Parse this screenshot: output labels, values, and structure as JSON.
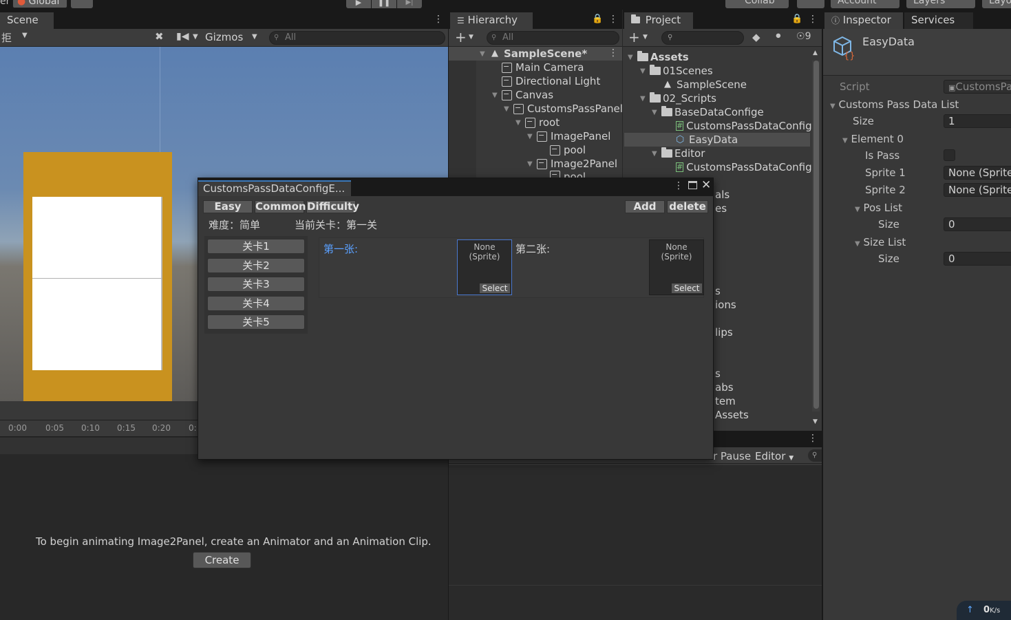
{
  "top_toolbar": {
    "left_fragment": "er",
    "global_label": "Global",
    "collab_label": "Collab",
    "account_label": "Account",
    "layers_label": "Layers",
    "layout_label": "Layo"
  },
  "scene": {
    "tab_label": "Scene",
    "toolbar_view": "拒",
    "gizmos_label": "Gizmos",
    "search_placeholder": "All"
  },
  "animation": {
    "timeline_ticks": [
      "0:00",
      "0:05",
      "0:10",
      "0:15",
      "0:20",
      "0:"
    ],
    "message": "To begin animating Image2Panel, create an Animator and an Animation Clip.",
    "create_label": "Create"
  },
  "hierarchy": {
    "tab_label": "Hierarchy",
    "search_placeholder": "All",
    "items": [
      {
        "label": "SampleScene*",
        "kind": "scene"
      },
      {
        "label": "Main Camera",
        "kind": "go"
      },
      {
        "label": "Directional Light",
        "kind": "go"
      },
      {
        "label": "Canvas",
        "kind": "go"
      },
      {
        "label": "CustomsPassPanel",
        "kind": "go"
      },
      {
        "label": "root",
        "kind": "go"
      },
      {
        "label": "ImagePanel",
        "kind": "go"
      },
      {
        "label": "pool",
        "kind": "go"
      },
      {
        "label": "Image2Panel",
        "kind": "go"
      },
      {
        "label": "pool",
        "kind": "go"
      }
    ]
  },
  "project": {
    "tab_label": "Project",
    "hidden_count": "9",
    "items": [
      {
        "label": "Assets",
        "kind": "folder"
      },
      {
        "label": "01Scenes",
        "kind": "folder"
      },
      {
        "label": "SampleScene",
        "kind": "scene"
      },
      {
        "label": "02_Scripts",
        "kind": "folder"
      },
      {
        "label": "BaseDataConfige",
        "kind": "folder"
      },
      {
        "label": "CustomsPassDataConfig",
        "kind": "script"
      },
      {
        "label": "EasyData",
        "kind": "asset"
      },
      {
        "label": "Editor",
        "kind": "folder"
      },
      {
        "label": "CustomsPassDataConfig",
        "kind": "script"
      }
    ],
    "partial_items": [
      "als",
      "es",
      "s",
      "ions",
      "lips",
      "s",
      "abs",
      "tem",
      "Assets"
    ],
    "console_pause": "r Pause",
    "console_editor": "Editor"
  },
  "inspector": {
    "tab_label": "Inspector",
    "services_label": "Services",
    "asset_name": "EasyData",
    "script_label": "Script",
    "script_value": "CustomsPa",
    "list_label": "Customs Pass Data List",
    "size_label": "Size",
    "size_value": "1",
    "element_label": "Element 0",
    "is_pass_label": "Is Pass",
    "sprite1_label": "Sprite 1",
    "sprite1_value": "None (Sprite)",
    "sprite2_label": "Sprite 2",
    "sprite2_value": "None (Sprite)",
    "pos_list_label": "Pos List",
    "pos_size_label": "Size",
    "pos_size_value": "0",
    "size_list_label": "Size List",
    "size_list_size_label": "Size",
    "size_list_size_value": "0",
    "network_speed": "0",
    "network_unit": "K/s"
  },
  "editor_window": {
    "title": "CustomsPassDataConfigE...",
    "tabs": [
      "Easy",
      "Common",
      "Difficulty"
    ],
    "add_label": "Add",
    "delete_label": "delete",
    "difficulty_text": "难度：简单",
    "current_level_text": "当前关卡：第一关",
    "levels": [
      "关卡1",
      "关卡2",
      "关卡3",
      "关卡4",
      "关卡5"
    ],
    "first_label": "第一张:",
    "second_label": "第二张:",
    "sprite_none": "None",
    "sprite_type": "(Sprite)",
    "select_label": "Select"
  }
}
